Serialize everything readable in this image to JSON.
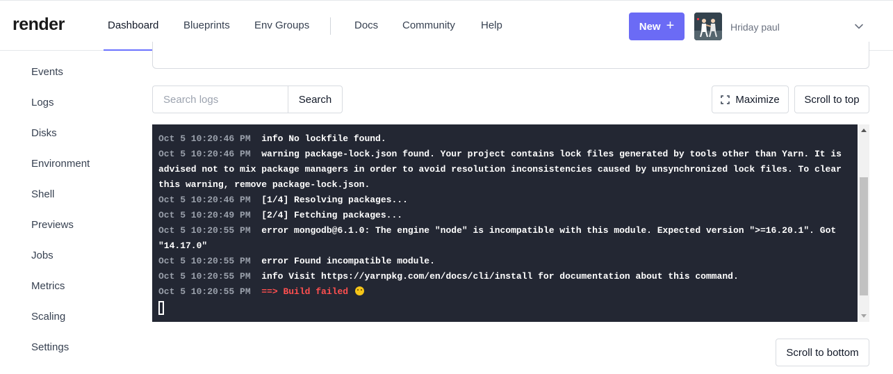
{
  "brand": "render",
  "nav": {
    "items": [
      "Dashboard",
      "Blueprints",
      "Env Groups",
      "Docs",
      "Community",
      "Help"
    ],
    "new_label": "New",
    "user_name": "Hriday paul"
  },
  "sidebar": {
    "items": [
      "Events",
      "Logs",
      "Disks",
      "Environment",
      "Shell",
      "Previews",
      "Jobs",
      "Metrics",
      "Scaling",
      "Settings"
    ]
  },
  "logs": {
    "search_placeholder": "Search logs",
    "search_label": "Search",
    "maximize_label": "Maximize",
    "scroll_top_label": "Scroll to top",
    "scroll_bottom_label": "Scroll to bottom",
    "lines": [
      {
        "time": "Oct 5 10:20:46 PM",
        "text": "info No lockfile found."
      },
      {
        "time": "Oct 5 10:20:46 PM",
        "text": "warning package-lock.json found. Your project contains lock files generated by tools other than Yarn. It is advised not to mix package managers in order to avoid resolution inconsistencies caused by unsynchronized lock files. To clear this warning, remove package-lock.json."
      },
      {
        "time": "Oct 5 10:20:46 PM",
        "text": "[1/4] Resolving packages..."
      },
      {
        "time": "Oct 5 10:20:49 PM",
        "text": "[2/4] Fetching packages..."
      },
      {
        "time": "Oct 5 10:20:55 PM",
        "text": "error mongodb@6.1.0: The engine \"node\" is incompatible with this module. Expected version \">=16.20.1\". Got \"14.17.0\""
      },
      {
        "time": "Oct 5 10:20:55 PM",
        "text": "error Found incompatible module."
      },
      {
        "time": "Oct 5 10:20:55 PM",
        "text": "info Visit https://yarnpkg.com/en/docs/cli/install for documentation about this command."
      },
      {
        "time": "Oct 5 10:20:55 PM",
        "text": "==> Build failed"
      }
    ],
    "error_color": "#ff4f4f",
    "scroll_position": 0.72
  },
  "colors": {
    "accent": "#6b6bf5",
    "terminal_bg": "#232733"
  }
}
